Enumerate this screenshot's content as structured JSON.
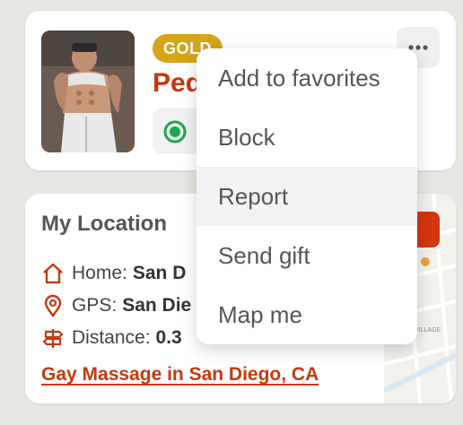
{
  "profile": {
    "badge": "GOLD",
    "name": "Ped",
    "more_icon": "more-horizontal-icon",
    "status_icon": "online-radio-icon",
    "status_color": "#1aa84b",
    "accent_color": "#c8380c",
    "badge_color": "#d6a417"
  },
  "location": {
    "title": "My Location",
    "home_label": "Home:",
    "home_value": "San D",
    "gps_label": "GPS:",
    "gps_value": "San Die",
    "distance_label": "Distance:",
    "distance_value": "0.3",
    "link_text": "Gay Massage in San Diego, CA"
  },
  "menu": {
    "items": [
      {
        "label": "Add to favorites"
      },
      {
        "label": "Block"
      },
      {
        "label": "Report"
      },
      {
        "label": "Send gift"
      },
      {
        "label": "Map me"
      }
    ],
    "hovered_index": 2
  },
  "map": {
    "village_label": "VILLAGE"
  }
}
